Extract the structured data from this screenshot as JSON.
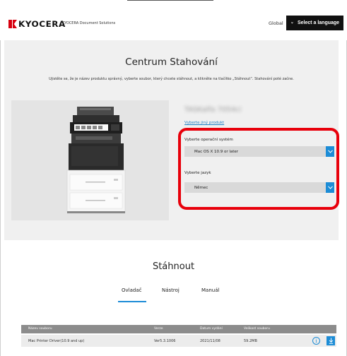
{
  "header": {
    "logo_text": "KYOCERA",
    "brand_sub": "KYOCERA Document Solutions",
    "global_label": "Global",
    "language_button": "Select a language"
  },
  "main": {
    "title": "Centrum Stahování",
    "subtitle": "Ujistěte se, že je název produktu správný, vyberte soubor, který chcete stáhnout, a klikněte na tlačítko „Stáhnout“. Stahování poté začne.",
    "product_name": "TASKalfa 7054ci",
    "other_product_link": "Vyberte jiný produkt",
    "os_label": "Vyberte operační systém",
    "os_value": "Mac OS X 10.9 or later",
    "language_label": "Vyberte jazyk",
    "language_value": "Němec"
  },
  "download": {
    "title": "Stáhnout",
    "tabs": [
      {
        "label": "Ovladač",
        "active": true
      },
      {
        "label": "Nástroj",
        "active": false
      },
      {
        "label": "Manuál",
        "active": false
      }
    ],
    "columns": [
      "Název souboru",
      "Verze",
      "Datum vydání",
      "Velikost souboru"
    ],
    "rows": [
      {
        "name": "Mac Printer Driver(10.9 and up)",
        "version": "Ver5.3.1006",
        "date": "2021/11/08",
        "size": "59.2MB"
      }
    ]
  },
  "colors": {
    "accent": "#1c8cd6",
    "highlight": "#e8000b",
    "brand": "#d7000f"
  }
}
